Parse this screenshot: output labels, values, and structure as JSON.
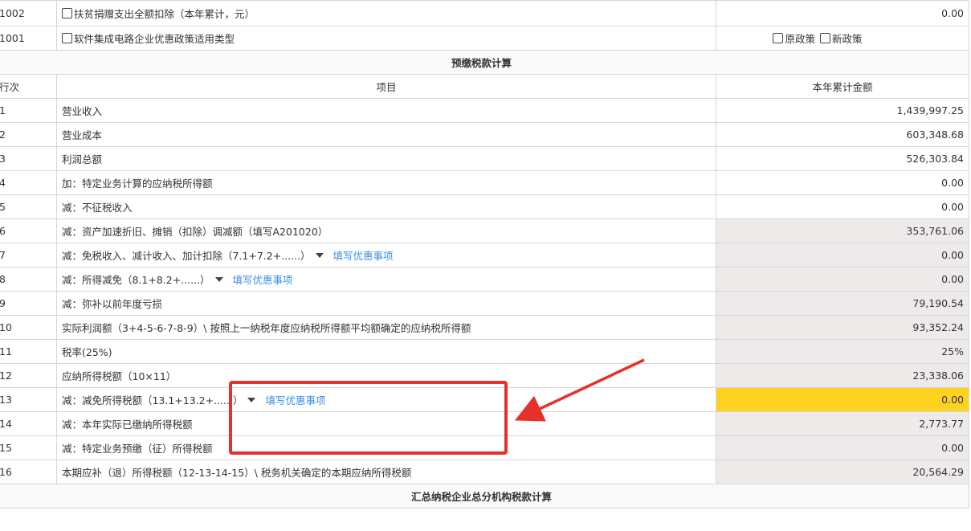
{
  "rows_top": [
    {
      "no": "1002",
      "label": "扶贫捐赠支出全额扣除（本年累计，元）",
      "value": "0.00"
    },
    {
      "no": "1001",
      "label": "软件集成电路企业优惠政策适用类型",
      "options": [
        "原政策",
        "新政策"
      ]
    }
  ],
  "section_title": "预缴税款计算",
  "columns": {
    "no": "行次",
    "item": "项目",
    "amount": "本年累计金额"
  },
  "rows": [
    {
      "no": "1",
      "label": "营业收入",
      "value": "1,439,997.25"
    },
    {
      "no": "2",
      "label": "营业成本",
      "value": "603,348.68"
    },
    {
      "no": "3",
      "label": "利润总额",
      "value": "526,303.84"
    },
    {
      "no": "4",
      "label": "加：特定业务计算的应纳税所得额",
      "value": "0.00"
    },
    {
      "no": "5",
      "label": "减：不征税收入",
      "value": "0.00"
    },
    {
      "no": "6",
      "label": "减：资产加速折旧、摊销（扣除）调减额（填写A201020）",
      "value": "353,761.06"
    },
    {
      "no": "7",
      "label": "减：免税收入、减计收入、加计扣除（7.1+7.2+......）",
      "value": "0.00",
      "link": "填写优惠事项"
    },
    {
      "no": "8",
      "label": "减：所得减免（8.1+8.2+......）",
      "value": "0.00",
      "link": "填写优惠事项"
    },
    {
      "no": "9",
      "label": "减：弥补以前年度亏损",
      "value": "79,190.54"
    },
    {
      "no": "10",
      "label": "实际利润额（3+4-5-6-7-8-9）\\ 按照上一纳税年度应纳税所得额平均额确定的应纳税所得额",
      "value": "93,352.24"
    },
    {
      "no": "11",
      "label": "税率(25%)",
      "value": "25%"
    },
    {
      "no": "12",
      "label": "应纳所得税额（10×11）",
      "value": "23,338.06"
    },
    {
      "no": "13",
      "label": "减：减免所得税额（13.1+13.2+......）",
      "value": "0.00",
      "link": "填写优惠事项"
    },
    {
      "no": "14",
      "label": "减：本年实际已缴纳所得税额",
      "value": "2,773.77"
    },
    {
      "no": "15",
      "label": "减：特定业务预缴（征）所得税额",
      "value": "0.00"
    },
    {
      "no": "16",
      "label": "本期应补（退）所得税额（12-13-14-15）\\ 税务机关确定的本期应纳所得税额",
      "value": "20,564.29"
    }
  ],
  "footer_title": "汇总纳税企业总分机构税款计算",
  "colors": {
    "highlight": "#ffd21f",
    "readonly": "#eeeaea",
    "link": "#3a8ee6",
    "annotation": "#e8302a"
  }
}
